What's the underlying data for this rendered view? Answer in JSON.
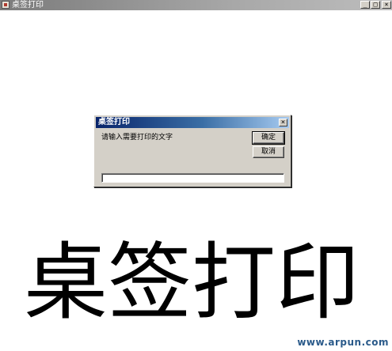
{
  "window": {
    "title": "桌签打印",
    "controls": {
      "minimize": "_",
      "maximize": "□",
      "close": "×"
    }
  },
  "dialog": {
    "title": "桌签打印",
    "close": "×",
    "prompt": "请输入需要打印的文字",
    "ok_label": "确定",
    "cancel_label": "取消",
    "input_value": ""
  },
  "banner_text": "桌签打印",
  "watermark": "www.arpun.com"
}
